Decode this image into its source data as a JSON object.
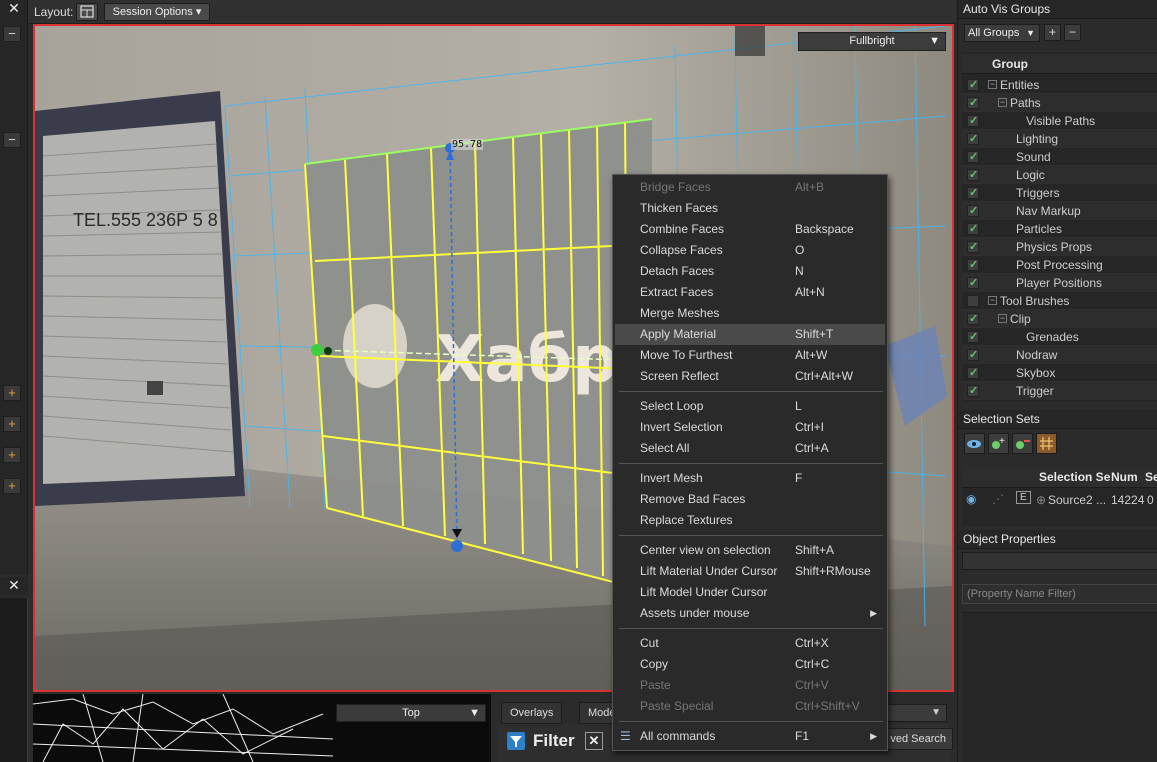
{
  "toolbar": {
    "layout_label": "Layout:",
    "session_options": "Session Options"
  },
  "viewport": {
    "render_mode": "Fullbright",
    "dimension": "95.78",
    "wall_text": "TEL.555 236P 5 8",
    "wall_logo": "Хабр"
  },
  "bottom_viewport": {
    "view_mode": "Top"
  },
  "bottom_panel": {
    "tabs": [
      "Overlays",
      "Mode"
    ],
    "filter_label": "Filter",
    "saved_search": "ved Search"
  },
  "right_panel": {
    "auto_vis_title": "Auto Vis Groups",
    "group_filter": "All Groups",
    "group_header": "Group",
    "groups": [
      {
        "label": "Entities",
        "indent": 0,
        "checked": true,
        "toggle": "−"
      },
      {
        "label": "Paths",
        "indent": 1,
        "checked": true,
        "toggle": "−"
      },
      {
        "label": "Visible Paths",
        "indent": 2,
        "checked": true,
        "toggle": ""
      },
      {
        "label": "Lighting",
        "indent": 1,
        "checked": true,
        "toggle": ""
      },
      {
        "label": "Sound",
        "indent": 1,
        "checked": true,
        "toggle": ""
      },
      {
        "label": "Logic",
        "indent": 1,
        "checked": true,
        "toggle": ""
      },
      {
        "label": "Triggers",
        "indent": 1,
        "checked": true,
        "toggle": ""
      },
      {
        "label": "Nav Markup",
        "indent": 1,
        "checked": true,
        "toggle": ""
      },
      {
        "label": "Particles",
        "indent": 1,
        "checked": true,
        "toggle": ""
      },
      {
        "label": "Physics Props",
        "indent": 1,
        "checked": true,
        "toggle": ""
      },
      {
        "label": "Post Processing",
        "indent": 1,
        "checked": true,
        "toggle": ""
      },
      {
        "label": "Player Positions",
        "indent": 1,
        "checked": true,
        "toggle": ""
      },
      {
        "label": "Tool Brushes",
        "indent": 0,
        "checked": false,
        "toggle": "−"
      },
      {
        "label": "Clip",
        "indent": 1,
        "checked": true,
        "toggle": "−"
      },
      {
        "label": "Grenades",
        "indent": 2,
        "checked": true,
        "toggle": ""
      },
      {
        "label": "Nodraw",
        "indent": 1,
        "checked": true,
        "toggle": ""
      },
      {
        "label": "Skybox",
        "indent": 1,
        "checked": true,
        "toggle": ""
      },
      {
        "label": "Trigger",
        "indent": 1,
        "checked": true,
        "toggle": ""
      }
    ],
    "selection_sets_title": "Selection Sets",
    "ss_columns": [
      "Selection Se",
      "Num",
      "Se"
    ],
    "ss_row": {
      "name": "Source2 ...",
      "num": "14224",
      "sel": "0"
    },
    "object_properties_title": "Object Properties",
    "property_filter_placeholder": "(Property Name Filter)"
  },
  "context_menu": [
    {
      "label": "Bridge Faces",
      "shortcut": "Alt+B",
      "disabled": true
    },
    {
      "label": "Thicken Faces",
      "shortcut": ""
    },
    {
      "label": "Combine Faces",
      "shortcut": "Backspace"
    },
    {
      "label": "Collapse Faces",
      "shortcut": "O"
    },
    {
      "label": "Detach Faces",
      "shortcut": "N"
    },
    {
      "label": "Extract Faces",
      "shortcut": "Alt+N"
    },
    {
      "label": "Merge Meshes",
      "shortcut": ""
    },
    {
      "label": "Apply Material",
      "shortcut": "Shift+T",
      "highlight": true
    },
    {
      "label": "Move To Furthest",
      "shortcut": "Alt+W"
    },
    {
      "label": "Screen Reflect",
      "shortcut": "Ctrl+Alt+W"
    },
    {
      "sep": true
    },
    {
      "label": "Select Loop",
      "shortcut": "L"
    },
    {
      "label": "Invert Selection",
      "shortcut": "Ctrl+I"
    },
    {
      "label": "Select All",
      "shortcut": "Ctrl+A"
    },
    {
      "sep": true
    },
    {
      "label": "Invert Mesh",
      "shortcut": "F"
    },
    {
      "label": "Remove Bad Faces",
      "shortcut": ""
    },
    {
      "label": "Replace Textures",
      "shortcut": ""
    },
    {
      "sep": true
    },
    {
      "label": "Center view on selection",
      "shortcut": "Shift+A"
    },
    {
      "label": "Lift Material Under Cursor",
      "shortcut": "Shift+RMouse"
    },
    {
      "label": "Lift Model Under Cursor",
      "shortcut": ""
    },
    {
      "label": "Assets under mouse",
      "shortcut": "",
      "submenu": true
    },
    {
      "sep": true
    },
    {
      "label": "Cut",
      "shortcut": "Ctrl+X"
    },
    {
      "label": "Copy",
      "shortcut": "Ctrl+C"
    },
    {
      "label": "Paste",
      "shortcut": "Ctrl+V",
      "disabled": true
    },
    {
      "label": "Paste Special",
      "shortcut": "Ctrl+Shift+V",
      "disabled": true
    },
    {
      "sep": true
    },
    {
      "label": "All commands",
      "shortcut": "F1",
      "submenu": true,
      "icon": true
    }
  ]
}
